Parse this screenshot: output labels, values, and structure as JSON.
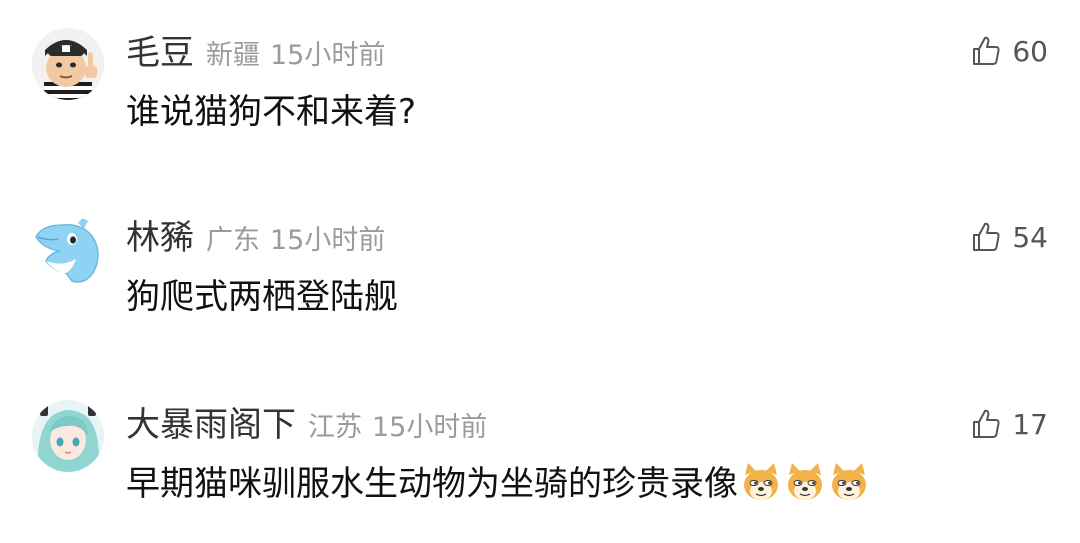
{
  "comments": [
    {
      "username": "毛豆",
      "region": "新疆",
      "time": "15小时前",
      "text": "谁说猫狗不和来着?",
      "likes": "60",
      "avatar_icon": "cartoon-boy-thumbs-up-avatar"
    },
    {
      "username": "林豨",
      "region": "广东",
      "time": "15小时前",
      "text": "狗爬式两栖登陆舰",
      "likes": "54",
      "avatar_icon": "dolphin-avatar"
    },
    {
      "username": "大暴雨阁下",
      "region": "江苏",
      "time": "15小时前",
      "text": "早期猫咪驯服水生动物为坐骑的珍贵录像",
      "likes": "17",
      "avatar_icon": "anime-girl-avatar",
      "emojis": [
        "doge-emoji",
        "doge-emoji",
        "doge-emoji"
      ]
    }
  ],
  "colors": {
    "username": "#333333",
    "meta": "#9b9b9b",
    "content": "#111111",
    "like_icon": "#555555"
  }
}
